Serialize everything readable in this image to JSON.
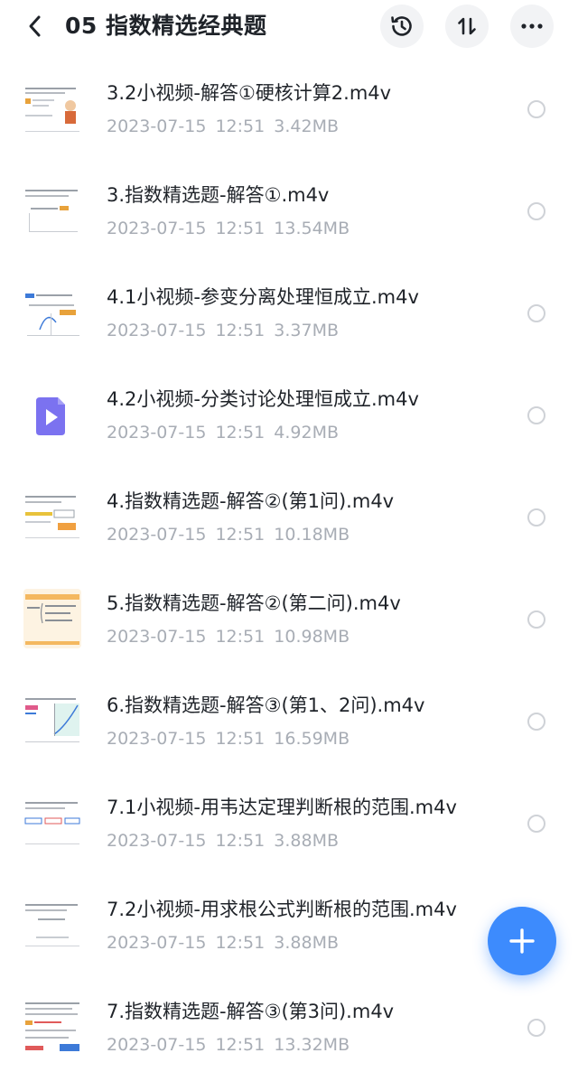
{
  "header": {
    "title": "05 指数精选经典题"
  },
  "files": [
    {
      "name": "3.2小视频-解答①硬核计算2.m4v",
      "date": "2023-07-15",
      "time": "12:51",
      "size": "3.42MB",
      "thumb": "slide-figure"
    },
    {
      "name": "3.指数精选题-解答①.m4v",
      "date": "2023-07-15",
      "time": "12:51",
      "size": "13.54MB",
      "thumb": "slide-formula"
    },
    {
      "name": "4.1小视频-参变分离处理恒成立.m4v",
      "date": "2023-07-15",
      "time": "12:51",
      "size": "3.37MB",
      "thumb": "slide-curve"
    },
    {
      "name": "4.2小视频-分类讨论处理恒成立.m4v",
      "date": "2023-07-15",
      "time": "12:51",
      "size": "4.92MB",
      "thumb": "video-file-icon"
    },
    {
      "name": "4.指数精选题-解答②(第1问).m4v",
      "date": "2023-07-15",
      "time": "12:51",
      "size": "10.18MB",
      "thumb": "slide-flow"
    },
    {
      "name": "5.指数精选题-解答②(第二问).m4v",
      "date": "2023-07-15",
      "time": "12:51",
      "size": "10.98MB",
      "thumb": "slide-cases"
    },
    {
      "name": "6.指数精选题-解答③(第1、2问).m4v",
      "date": "2023-07-15",
      "time": "12:51",
      "size": "16.59MB",
      "thumb": "slide-graph"
    },
    {
      "name": "7.1小视频-用韦达定理判断根的范围.m4v",
      "date": "2023-07-15",
      "time": "12:51",
      "size": "3.88MB",
      "thumb": "slide-boxes"
    },
    {
      "name": "7.2小视频-用求根公式判断根的范围.m4v",
      "date": "2023-07-15",
      "time": "12:51",
      "size": "3.88MB",
      "thumb": "slide-text"
    },
    {
      "name": "7.指数精选题-解答③(第3问).m4v",
      "date": "2023-07-15",
      "time": "12:51",
      "size": "13.32MB",
      "thumb": "slide-dense"
    }
  ],
  "colors": {
    "accent": "#3d8bfd",
    "video_icon": "#7b72f0",
    "meta_text": "#a8adb5"
  }
}
